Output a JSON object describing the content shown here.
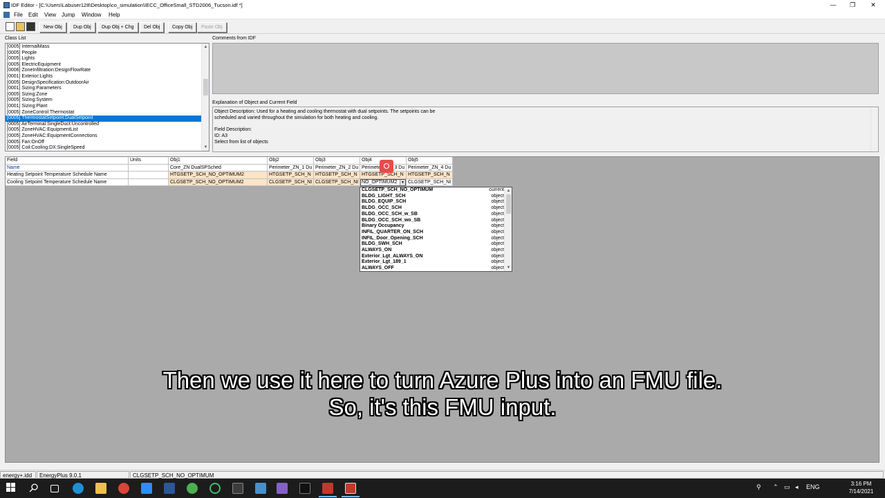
{
  "window": {
    "title": "IDF Editor - [C:\\Users\\Labuser128\\Desktop\\co_simulation\\IECC_OfficeSmall_STD2006_Tucson.idf *]",
    "minimize": "—",
    "restore": "❐",
    "close": "✕"
  },
  "menu": [
    "File",
    "Edit",
    "View",
    "Jump",
    "Window",
    "Help"
  ],
  "toolbar": {
    "icons": [
      "new-file-icon",
      "open-folder-icon",
      "save-disk-icon"
    ],
    "buttons": [
      {
        "label": "New Obj",
        "enabled": true
      },
      {
        "label": "Dup Obj",
        "enabled": true
      },
      {
        "label": "Dup Obj + Chg",
        "enabled": true
      },
      {
        "label": "Del Obj",
        "enabled": true
      },
      {
        "label": "Copy Obj",
        "enabled": true
      },
      {
        "label": "Paste Obj",
        "enabled": false
      }
    ]
  },
  "class_list": {
    "label": "Class List",
    "items": [
      "[0005]  InternalMass",
      "[0005]  People",
      "[0005]  Lights",
      "[0005]  ElectricEquipment",
      "[0006]  ZoneInfiltration:DesignFlowRate",
      "[0001]  Exterior:Lights",
      "[0005]  DesignSpecification:OutdoorAir",
      "[0001]  Sizing:Parameters",
      "[0005]  Sizing:Zone",
      "[0005]  Sizing:System",
      "[0001]  Sizing:Plant",
      "[0005]  ZoneControl:Thermostat",
      "[0005]  ThermostatSetpoint:DualSetpoint",
      "[0005]  AirTerminal:SingleDuct:Uncontrolled",
      "[0005]  ZoneHVAC:EquipmentList",
      "[0005]  ZoneHVAC:EquipmentConnections",
      "[0005]  Fan:OnOff",
      "[0005]  Coil:Cooling:DX:SingleSpeed"
    ],
    "selected_index": 12
  },
  "comments": {
    "label": "Comments from IDF"
  },
  "explanation": {
    "label": "Explanation of Object and Current Field",
    "lines": [
      "Object Description: Used for a heating and cooling thermostat with dual setpoints. The setpoints can be",
      "scheduled and varied throughout the simulation for both heating and cooling.",
      "",
      "Field Description:",
      "ID: A3",
      "Select from list of objects"
    ]
  },
  "grid": {
    "headers": [
      "Field",
      "Units",
      "Obj1",
      "Obj2",
      "Obj3",
      "Obj4",
      "Obj5"
    ],
    "rows": [
      {
        "field": "Name",
        "units": "",
        "values": [
          "Core_ZN DualSPSched",
          "Perimeter_ZN_1 Du",
          "Perimeter_ZN_2 Du",
          "Perimeter_ZN_3 Du",
          "Perimeter_ZN_4 Du"
        ]
      },
      {
        "field": "Heating Setpoint Temperature Schedule Name",
        "units": "",
        "values": [
          "HTGSETP_SCH_NO_OPTIMUM2",
          "HTGSETP_SCH_N",
          "HTGSETP_SCH_N",
          "HTGSETP_SCH_N",
          "HTGSETP_SCH_N"
        ]
      },
      {
        "field": "Cooling Setpoint Temperature Schedule Name",
        "units": "",
        "values": [
          "CLGSETP_SCH_NO_OPTIMUM2",
          "CLGSETP_SCH_NI",
          "CLGSETP_SCH_NI",
          "NO_OPTIMUM2",
          "CLGSETP_SCH_NI"
        ]
      }
    ]
  },
  "dropdown": {
    "selected": "NO_OPTIMUM2",
    "options": [
      {
        "name": "CLGSETP_SCH_NO_OPTIMUM",
        "type": "current"
      },
      {
        "name": "BLDG_LIGHT_SCH",
        "type": "object"
      },
      {
        "name": "BLDG_EQUIP_SCH",
        "type": "object"
      },
      {
        "name": "BLDG_OCC_SCH",
        "type": "object"
      },
      {
        "name": "BLDG_OCC_SCH_w_SB",
        "type": "object"
      },
      {
        "name": "BLDG_OCC_SCH_wo_SB",
        "type": "object"
      },
      {
        "name": "Binary Occupancy",
        "type": "object"
      },
      {
        "name": "INFIL_QUARTER_ON_SCH",
        "type": "object"
      },
      {
        "name": "INFIL_Door_Opening_SCH",
        "type": "object"
      },
      {
        "name": "BLDG_SWH_SCH",
        "type": "object"
      },
      {
        "name": "ALWAYS_ON",
        "type": "object"
      },
      {
        "name": "Exterior_Lgt_ALWAYS_ON",
        "type": "object"
      },
      {
        "name": "Exterior_Lgt_189_1",
        "type": "object"
      },
      {
        "name": "ALWAYS_OFF",
        "type": "object"
      }
    ]
  },
  "status": {
    "idd": "energy+.idd",
    "version": "EnergyPlus 9.0.1",
    "value": "CLGSETP_SCH_NO_OPTIMUM"
  },
  "subtitle": {
    "line1": "Then we use it here to turn Azure Plus into an FMU file.",
    "line2": "So, it's this FMU input."
  },
  "taskbar": {
    "apps": [
      "start-icon",
      "search-icon",
      "task-view-icon",
      "edge-icon",
      "file-explorer-icon",
      "chrome-icon",
      "zoom-icon",
      "word-icon",
      "chrome-icon",
      "refresh-app-icon",
      "terminal-icon",
      "remote-desktop-icon",
      "visual-studio-icon",
      "cmd-icon",
      "energyplus-launch-icon",
      "idf-editor-icon"
    ],
    "lang": "ENG",
    "time": "3:16 PM",
    "date": "7/14/2021"
  }
}
